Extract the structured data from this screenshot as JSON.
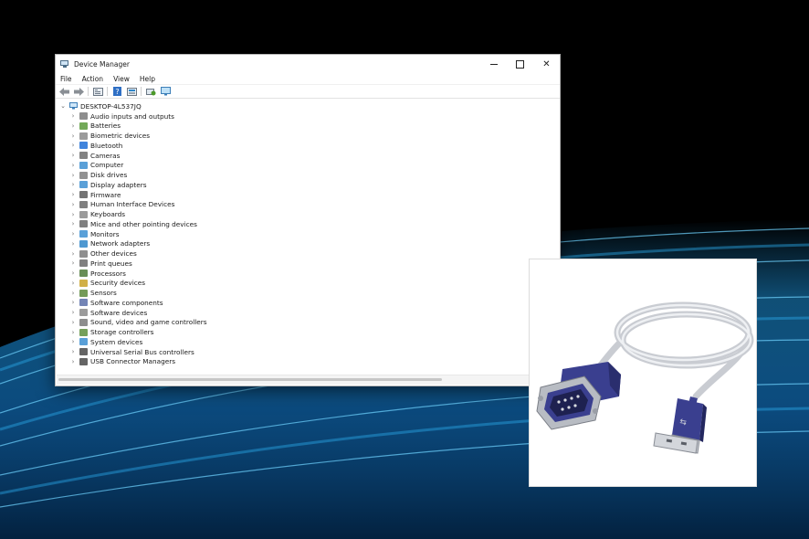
{
  "window": {
    "title": "Device Manager",
    "menu": [
      "File",
      "Action",
      "View",
      "Help"
    ],
    "toolbar_icons": [
      "back-arrow-icon",
      "forward-arrow-icon",
      "properties-icon",
      "help-icon",
      "details-icon",
      "scan-hardware-icon",
      "monitor-icon"
    ]
  },
  "tree": {
    "root": {
      "label": "DESKTOP-4L537JQ",
      "icon": "computer-icon"
    },
    "categories": [
      {
        "label": "Audio inputs and outputs",
        "icon": "speaker-icon",
        "color": "#7a7a7a"
      },
      {
        "label": "Batteries",
        "icon": "battery-icon",
        "color": "#5a9a3c"
      },
      {
        "label": "Biometric devices",
        "icon": "fingerprint-icon",
        "color": "#8a8a8a"
      },
      {
        "label": "Bluetooth",
        "icon": "bluetooth-icon",
        "color": "#1e6fd6"
      },
      {
        "label": "Cameras",
        "icon": "camera-icon",
        "color": "#6d6d6d"
      },
      {
        "label": "Computer",
        "icon": "computer-icon",
        "color": "#3d8fd1"
      },
      {
        "label": "Disk drives",
        "icon": "disk-drive-icon",
        "color": "#7f7f7f"
      },
      {
        "label": "Display adapters",
        "icon": "display-adapter-icon",
        "color": "#3d8fd1"
      },
      {
        "label": "Firmware",
        "icon": "firmware-icon",
        "color": "#5c5c5c"
      },
      {
        "label": "Human Interface Devices",
        "icon": "hid-icon",
        "color": "#6a6a6a"
      },
      {
        "label": "Keyboards",
        "icon": "keyboard-icon",
        "color": "#8a8a8a"
      },
      {
        "label": "Mice and other pointing devices",
        "icon": "mouse-icon",
        "color": "#6a6a6a"
      },
      {
        "label": "Monitors",
        "icon": "monitor-icon",
        "color": "#3d8fd1"
      },
      {
        "label": "Network adapters",
        "icon": "network-adapter-icon",
        "color": "#2f86c9"
      },
      {
        "label": "Other devices",
        "icon": "other-devices-icon",
        "color": "#7a7a7a"
      },
      {
        "label": "Print queues",
        "icon": "printer-icon",
        "color": "#6a6a6a"
      },
      {
        "label": "Processors",
        "icon": "processor-icon",
        "color": "#4f7a3a"
      },
      {
        "label": "Security devices",
        "icon": "security-icon",
        "color": "#c9a227"
      },
      {
        "label": "Sensors",
        "icon": "sensor-icon",
        "color": "#5c8a3c"
      },
      {
        "label": "Software components",
        "icon": "software-component-icon",
        "color": "#5b6ea8"
      },
      {
        "label": "Software devices",
        "icon": "software-device-icon",
        "color": "#8a8a8a"
      },
      {
        "label": "Sound, video and game controllers",
        "icon": "speaker-icon",
        "color": "#7a7a7a"
      },
      {
        "label": "Storage controllers",
        "icon": "storage-controller-icon",
        "color": "#5e8f3d"
      },
      {
        "label": "System devices",
        "icon": "system-devices-icon",
        "color": "#3d8fd1"
      },
      {
        "label": "Universal Serial Bus controllers",
        "icon": "usb-icon",
        "color": "#4a4a4a"
      },
      {
        "label": "USB Connector Managers",
        "icon": "usb-icon",
        "color": "#4a4a4a"
      }
    ]
  },
  "photo": {
    "subject": "usb-to-serial-cable-image",
    "plug_color": "#3a3f8f"
  },
  "colors": {
    "background_glow": "#2aa7e6",
    "window_bg": "#ffffff"
  }
}
